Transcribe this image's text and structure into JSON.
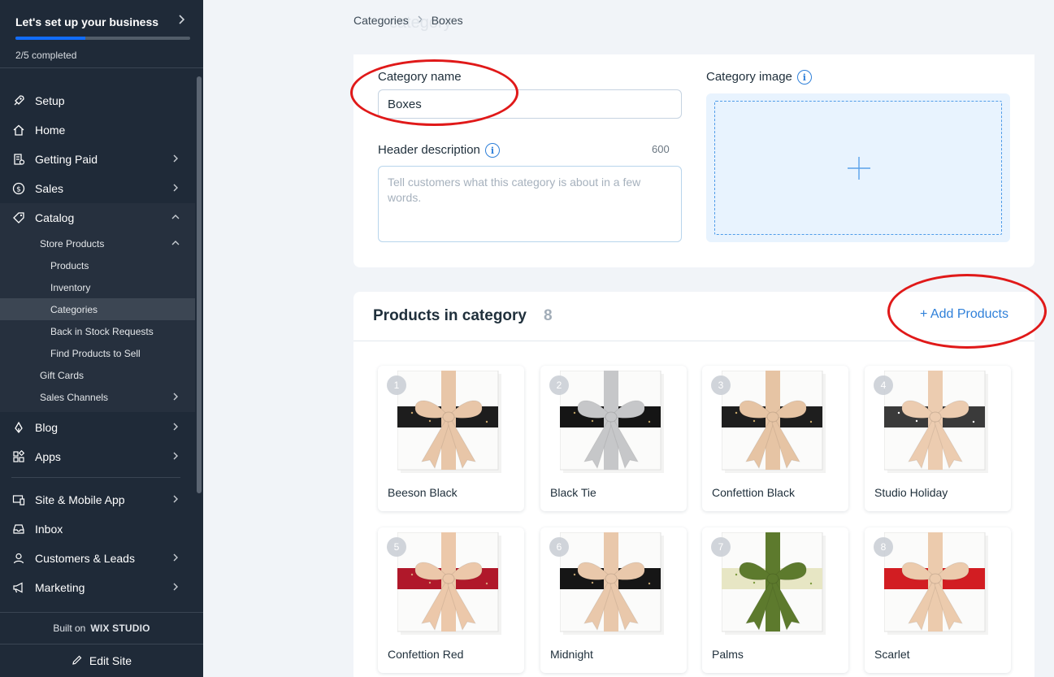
{
  "sidebar": {
    "setup": {
      "title": "Let's set up your business",
      "progress_text": "2/5 completed",
      "progress": 0.4
    },
    "items": [
      {
        "label": "Setup",
        "icon": "rocket-icon"
      },
      {
        "label": "Home",
        "icon": "home-icon"
      },
      {
        "label": "Getting Paid",
        "icon": "receipt-icon"
      },
      {
        "label": "Sales",
        "icon": "dollar-icon"
      },
      {
        "label": "Catalog",
        "icon": "tag-icon"
      },
      {
        "label": "Blog",
        "icon": "pen-icon"
      },
      {
        "label": "Apps",
        "icon": "apps-icon"
      },
      {
        "label": "Site & Mobile App",
        "icon": "site-icon"
      },
      {
        "label": "Inbox",
        "icon": "inbox-icon"
      },
      {
        "label": "Customers & Leads",
        "icon": "person-icon"
      },
      {
        "label": "Marketing",
        "icon": "megaphone-icon"
      }
    ],
    "catalog_sub": {
      "store_products": "Store Products",
      "products": "Products",
      "inventory": "Inventory",
      "categories": "Categories",
      "back_in_stock": "Back in Stock Requests",
      "find_products": "Find Products to Sell",
      "gift_cards": "Gift Cards",
      "sales_channels": "Sales Channels"
    },
    "built_on": "Built on",
    "brand": "WIX STUDIO",
    "edit_site": "Edit Site"
  },
  "breadcrumb": {
    "parent": "Categories",
    "current": "Boxes",
    "ghost": "category"
  },
  "form": {
    "category_name_label": "Category name",
    "category_name_value": "Boxes",
    "header_desc_label": "Header description",
    "header_desc_placeholder": "Tell customers what this category is about in a few words.",
    "char_count": "600",
    "category_image_label": "Category image"
  },
  "products_section": {
    "title": "Products in category",
    "count": "8",
    "add_button": "+ Add Products",
    "products": [
      {
        "index": "1",
        "name": "Beeson Black",
        "band": "#1d1d1d",
        "ribbon": "#e8c6a8",
        "accent": "#c9a46a"
      },
      {
        "index": "2",
        "name": "Black Tie",
        "band": "#151515",
        "ribbon": "#c6c7c9",
        "accent": "#b79b5e"
      },
      {
        "index": "3",
        "name": "Confettion Black",
        "band": "#1e1e1e",
        "ribbon": "#e6c4a4",
        "accent": "#caa86a"
      },
      {
        "index": "4",
        "name": "Studio Holiday",
        "band": "#3a3a3a",
        "ribbon": "#ecccb0",
        "accent": "#ffffff"
      },
      {
        "index": "5",
        "name": "Confettion Red",
        "band": "#b0182a",
        "ribbon": "#ecc8aa",
        "accent": "#d9a07a"
      },
      {
        "index": "6",
        "name": "Midnight",
        "band": "#161616",
        "ribbon": "#e9c8ab",
        "accent": "#bfa16e"
      },
      {
        "index": "7",
        "name": "Palms",
        "band": "#e7e6c4",
        "ribbon": "#5d7a2d",
        "accent": "#7c9b3e"
      },
      {
        "index": "8",
        "name": "Scarlet",
        "band": "#d21d22",
        "ribbon": "#eccbad",
        "accent": "#d21d22"
      }
    ]
  },
  "colors": {
    "sidebar_bg": "#1f2a38",
    "accent": "#2f80d9",
    "annotation": "#e01919",
    "progress": "#116dff"
  }
}
